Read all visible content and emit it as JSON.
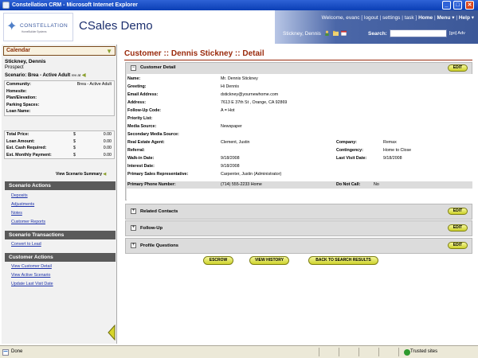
{
  "window": {
    "title": "Constellation CRM - Microsoft Internet Explorer"
  },
  "header": {
    "logo_text": "CONSTELLATION",
    "logo_tagline": "HomeBuilder Systems",
    "app_title": "CSales Demo",
    "welcome": "Welcome, evanc",
    "links": [
      "logout",
      "settings",
      "task"
    ],
    "home_label": "Home",
    "menu_label": "Menu",
    "help_label": "Help",
    "user_name": "Stickney, Dennis",
    "search_label": "Search:",
    "search_value": "",
    "go_label": "[go]",
    "adv_label": "Adv"
  },
  "sidebar": {
    "calendar_label": "Calendar",
    "contact_name": "Stickney, Dennis",
    "contact_status": "Prospect",
    "scenario_label": "Scenario: Brea - Active Adult",
    "scenario_link": "rev at",
    "info_rows": [
      {
        "label": "Community:",
        "value": "Brea - Active Adult"
      },
      {
        "label": "Homesite:",
        "value": ""
      },
      {
        "label": "Plan/Elevation:",
        "value": ""
      },
      {
        "label": "Parking Spaces:",
        "value": ""
      },
      {
        "label": "Loan Name:",
        "value": ""
      }
    ],
    "price_rows": [
      {
        "label": "Total Price:",
        "currency": "$",
        "value": "0.00"
      },
      {
        "label": "Loan Amount:",
        "currency": "$",
        "value": "0.00"
      },
      {
        "label": "Est. Cash Required:",
        "currency": "$",
        "value": "0.00"
      },
      {
        "label": "Est. Monthly Payment:",
        "currency": "$",
        "value": "0.00"
      }
    ],
    "view_summary": "View Scenario Summary",
    "sections": [
      {
        "title": "Scenario Actions",
        "links": [
          "Deposits",
          "Adjustments",
          "Notes",
          "Customer Reports"
        ]
      },
      {
        "title": "Scenario Transactions",
        "links": [
          "Convert to Lead"
        ]
      },
      {
        "title": "Customer Actions",
        "links": [
          "View Customer Detail",
          "View Active Scenario",
          "Update Last Visit Date"
        ]
      }
    ]
  },
  "main": {
    "page_title": "Customer :: Dennis Stickney :: Detail",
    "customer_detail": {
      "header": "Customer Detail",
      "edit_label": "EDIT",
      "fields": [
        {
          "label": "Name:",
          "value": "Mr. Dennis Stickney"
        },
        {
          "label": "Greeting:",
          "value": "Hi Dennis"
        },
        {
          "label": "Email Address:",
          "value": "dstickney@yournewhome.com"
        },
        {
          "label": "Address:",
          "value": "7613 E 37th St , Orange, CA 92869"
        },
        {
          "label": "Follow-Up Code:",
          "value": "A = Hot"
        },
        {
          "label": "Priority List:",
          "value": ""
        },
        {
          "label": "Media Source:",
          "value": "Newspaper"
        },
        {
          "label": "Secondary Media Source:",
          "value": ""
        },
        {
          "label": "Real Estate Agent:",
          "value": "Clement, Justin"
        },
        {
          "label": "Referral:",
          "value": ""
        },
        {
          "label": "Walk-in Date:",
          "value": "9/18/2008"
        },
        {
          "label": "Interest Date:",
          "value": "9/18/2008"
        },
        {
          "label": "Primary Sales Representative:",
          "value": "Carpenter, Justin   (Administrator)"
        }
      ],
      "right_fields": [
        {
          "label": "Company:",
          "value": "Remax"
        },
        {
          "label": "Contingency:",
          "value": "Home to Close"
        },
        {
          "label": "Last Visit Date:",
          "value": "9/18/2008"
        }
      ],
      "phone": {
        "label": "Primary Phone Number:",
        "value": "(714) 555-2233  Home",
        "dnc_label": "Do Not Call:",
        "dnc_value": "No"
      }
    },
    "collapsed_panels": [
      {
        "header": "Related Contacts",
        "edit_label": "EDIT"
      },
      {
        "header": "Follow-Up",
        "edit_label": "EDIT"
      },
      {
        "header": "Profile Questions",
        "edit_label": "EDIT"
      }
    ],
    "action_buttons": [
      "ESCROW",
      "VIEW HISTORY",
      "BACK TO SEARCH RESULTS"
    ]
  },
  "statusbar": {
    "status": "Done",
    "zone": "Trusted sites"
  }
}
